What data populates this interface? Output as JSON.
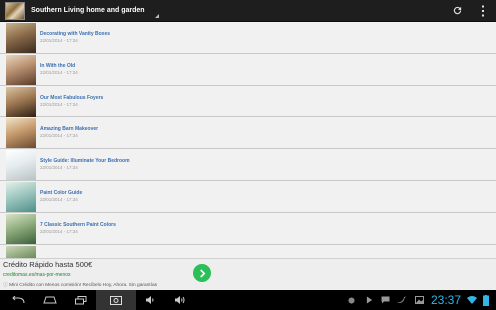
{
  "actionbar": {
    "title": "Southern Living home and garden",
    "refresh_icon": "refresh-icon",
    "overflow_icon": "overflow-menu-icon"
  },
  "list": {
    "items": [
      {
        "title": "Decorating with Vanity Boxes",
        "date": "22/01/2014 - 17:34",
        "thumb_colors": [
          "#3a2a1e",
          "#8a6a4a",
          "#c9b48d"
        ]
      },
      {
        "title": "In With the Old",
        "date": "22/01/2014 - 17:34",
        "thumb_colors": [
          "#5a3a2a",
          "#b89070",
          "#e8d7c0"
        ]
      },
      {
        "title": "Our Most Fabulous Foyers",
        "date": "22/01/2014 - 17:34",
        "thumb_colors": [
          "#2d1e14",
          "#a07a54",
          "#d9c4a2"
        ]
      },
      {
        "title": "Amazing Barn Makeover",
        "date": "22/01/2014 - 17:34",
        "thumb_colors": [
          "#6b4a30",
          "#c69c6d",
          "#f0e2c8"
        ]
      },
      {
        "title": "Style Guide: Illuminate Your Bedroom",
        "date": "22/01/2014 - 17:34",
        "thumb_colors": [
          "#b8c2c6",
          "#e6ecef",
          "#ffffff"
        ]
      },
      {
        "title": "Paint Color Guide",
        "date": "22/01/2014 - 17:34",
        "thumb_colors": [
          "#4e8f8a",
          "#9ec7c0",
          "#e4efe8"
        ]
      },
      {
        "title": "7 Classic Southern Paint Colors",
        "date": "22/01/2014 - 17:34",
        "thumb_colors": [
          "#3c5e3a",
          "#8fae7e",
          "#d8e2c8"
        ]
      },
      {
        "title": "",
        "date": "",
        "thumb_colors": [
          "#2f4a2c",
          "#7c9a6a",
          "#cdd8bc"
        ]
      }
    ]
  },
  "ad": {
    "title": "Crédito Rápido hasta 500€",
    "url": "creditomas.es/mas-por-menos",
    "description": "Mini Crédito con Menos comisión! Recíbelo Hoy, Ahora. Sin garantías",
    "go_icon": "arrow-right-icon"
  },
  "system_bar": {
    "time": "23:37",
    "nav_icons": [
      "back-icon",
      "home-icon",
      "recent-apps-icon",
      "screenshot-icon",
      "volume-down-icon",
      "volume-up-icon"
    ],
    "status_icons": [
      "record-icon",
      "play-store-icon",
      "chat-icon",
      "twitter-icon",
      "gallery-icon",
      "wifi-icon",
      "battery-icon"
    ]
  }
}
